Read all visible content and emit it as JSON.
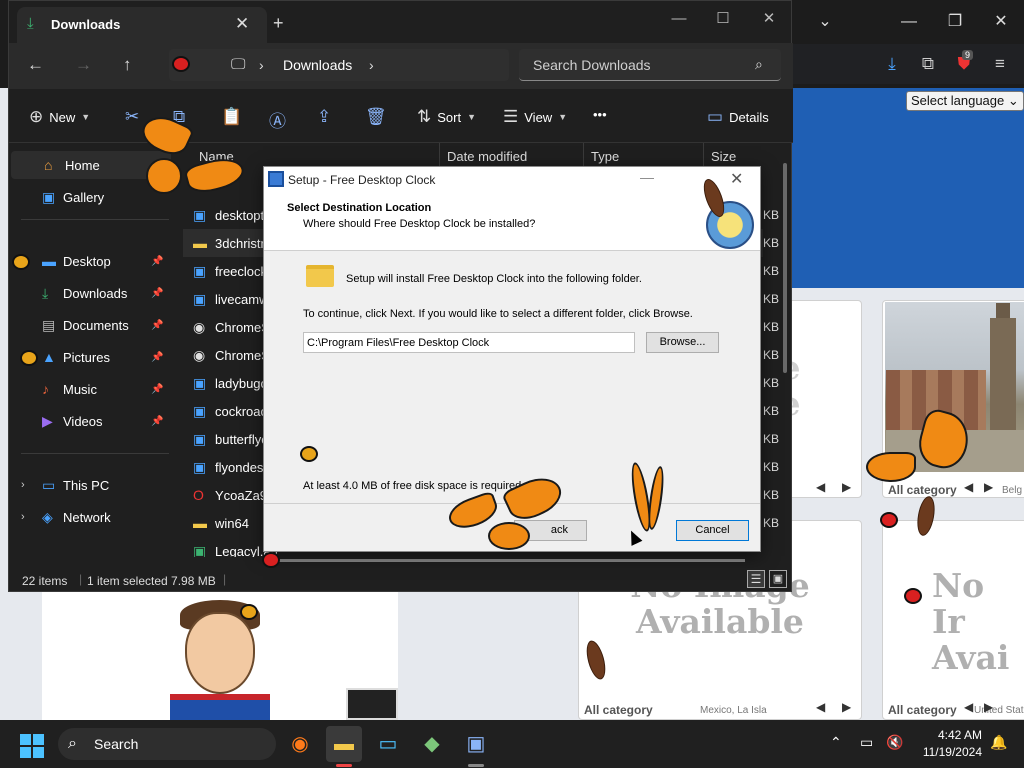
{
  "browser": {
    "language_select": "Select language ⌄",
    "ext_badge": "9",
    "cards": {
      "noimg_text": "No Image Available",
      "noimg_partial": "No Ir Avai",
      "cat1": "All category",
      "loc1": "Belg",
      "cat2": "All category",
      "loc2": "Mexico, La Isla",
      "cat3": "All category",
      "loc3": "United Stat",
      "ghost1": "e",
      "ghost2": "e"
    }
  },
  "explorer": {
    "tab_title": "Downloads",
    "address": {
      "location": "Downloads"
    },
    "search_placeholder": "Search Downloads",
    "commands": {
      "new": "New",
      "sort": "Sort",
      "view": "View",
      "more": "•••",
      "details": "Details"
    },
    "sidebar": {
      "home": "Home",
      "gallery": "Gallery",
      "desktop": "Desktop",
      "downloads": "Downloads",
      "documents": "Documents",
      "pictures": "Pictures",
      "music": "Music",
      "videos": "Videos",
      "this_pc": "This PC",
      "network": "Network"
    },
    "columns": {
      "name": "Name",
      "date": "Date modified",
      "type": "Type",
      "size": "Size"
    },
    "files": [
      {
        "name": "desktoptim",
        "size": "KB"
      },
      {
        "name": "3dchristma",
        "size": "KB"
      },
      {
        "name": "freeclock",
        "size": "KB"
      },
      {
        "name": "livecamwa",
        "size": "KB"
      },
      {
        "name": "ChromeSet",
        "size": "KB"
      },
      {
        "name": "ChromeSet",
        "size": "KB"
      },
      {
        "name": "ladybugon",
        "size": "KB"
      },
      {
        "name": "cockroach",
        "size": "KB"
      },
      {
        "name": "butterflyor",
        "size": "KB"
      },
      {
        "name": "flyondeskt",
        "size": "KB"
      },
      {
        "name": "YcoaZa95",
        "size": "KB"
      },
      {
        "name": "win64",
        "size": "KB"
      },
      {
        "name": "Legacyl.au",
        "size": ""
      }
    ],
    "status": {
      "count": "22 items",
      "selected": "1 item selected  7.98 MB"
    }
  },
  "dialog": {
    "title": "Setup - Free Desktop Clock",
    "heading": "Select Destination Location",
    "subheading": "Where should Free Desktop Clock be installed?",
    "install_text": "Setup will install Free Desktop Clock into the following folder.",
    "continue_text": "To continue, click Next. If you would like to select a different folder, click Browse.",
    "path": "C:\\Program Files\\Free Desktop Clock",
    "browse": "Browse...",
    "space_text": "At least 4.0 MB of free disk space is required.",
    "back": "ack",
    "cancel": "Cancel"
  },
  "taskbar": {
    "search_label": "Search",
    "time": "4:42 AM",
    "date": "11/19/2024"
  }
}
